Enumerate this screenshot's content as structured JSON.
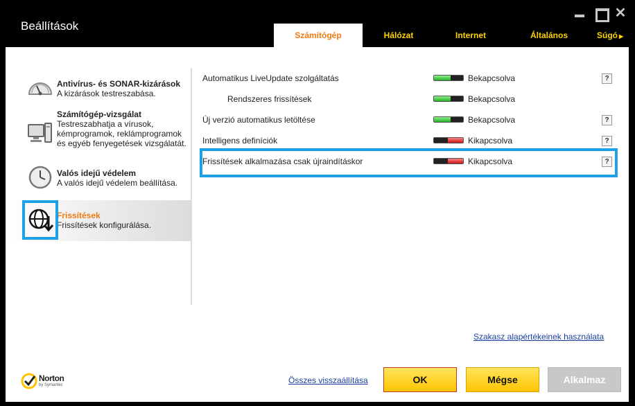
{
  "window": {
    "title": "Beállítások",
    "close_glyph": "✕"
  },
  "tabs": [
    {
      "label": "Számítógép",
      "active": true
    },
    {
      "label": "Hálózat",
      "active": false
    },
    {
      "label": "Internet",
      "active": false
    },
    {
      "label": "Általános",
      "active": false
    },
    {
      "label": "Súgó",
      "active": false
    }
  ],
  "sidebar": {
    "items": [
      {
        "title": "Antivírus- és SONAR-kizárások",
        "desc": "A kizárások testreszabása.",
        "icon": "gauge-icon",
        "selected": false
      },
      {
        "title": "Számítógép-vizsgálat",
        "desc": "Testreszabhatja a vírusok, kémprogramok, reklámprogramok és egyéb fenyegetések vizsgálatát.",
        "icon": "computer-icon",
        "selected": false
      },
      {
        "title": "Valós idejű védelem",
        "desc": "A valós idejű védelem beállítása.",
        "icon": "clock-icon",
        "selected": false
      },
      {
        "title": "Frissítések",
        "desc": "Frissítések konfigurálása.",
        "icon": "globe-download-icon",
        "selected": true
      }
    ]
  },
  "settings": [
    {
      "label": "Automatikus LiveUpdate szolgáltatás",
      "state": "Bekapcsolva",
      "on": true,
      "indent": false,
      "help": "?"
    },
    {
      "label": "Rendszeres frissítések",
      "state": "Bekapcsolva",
      "on": true,
      "indent": true,
      "help": ""
    },
    {
      "label": "Új verzió automatikus letöltése",
      "state": "Bekapcsolva",
      "on": true,
      "indent": false,
      "help": "?"
    },
    {
      "label": "Intelligens definíciók",
      "state": "Kikapcsolva",
      "on": false,
      "indent": false,
      "help": "?"
    },
    {
      "label": "Frissítések alkalmazása csak újraindításkor",
      "state": "Kikapcsolva",
      "on": false,
      "indent": false,
      "help": "?"
    }
  ],
  "links": {
    "defaults": "Szakasz alapértékeinek használata",
    "reset_all": "Összes visszaállítása"
  },
  "buttons": {
    "ok": "OK",
    "cancel": "Mégse",
    "apply": "Alkalmaz"
  },
  "brand": {
    "name": "Norton",
    "sub": "by Symantec"
  },
  "colors": {
    "accent": "#ef7a12",
    "tab_text": "#ffd200",
    "highlight": "#1ea0e6",
    "toggle_on": "#24b024",
    "toggle_off": "#c81818"
  }
}
